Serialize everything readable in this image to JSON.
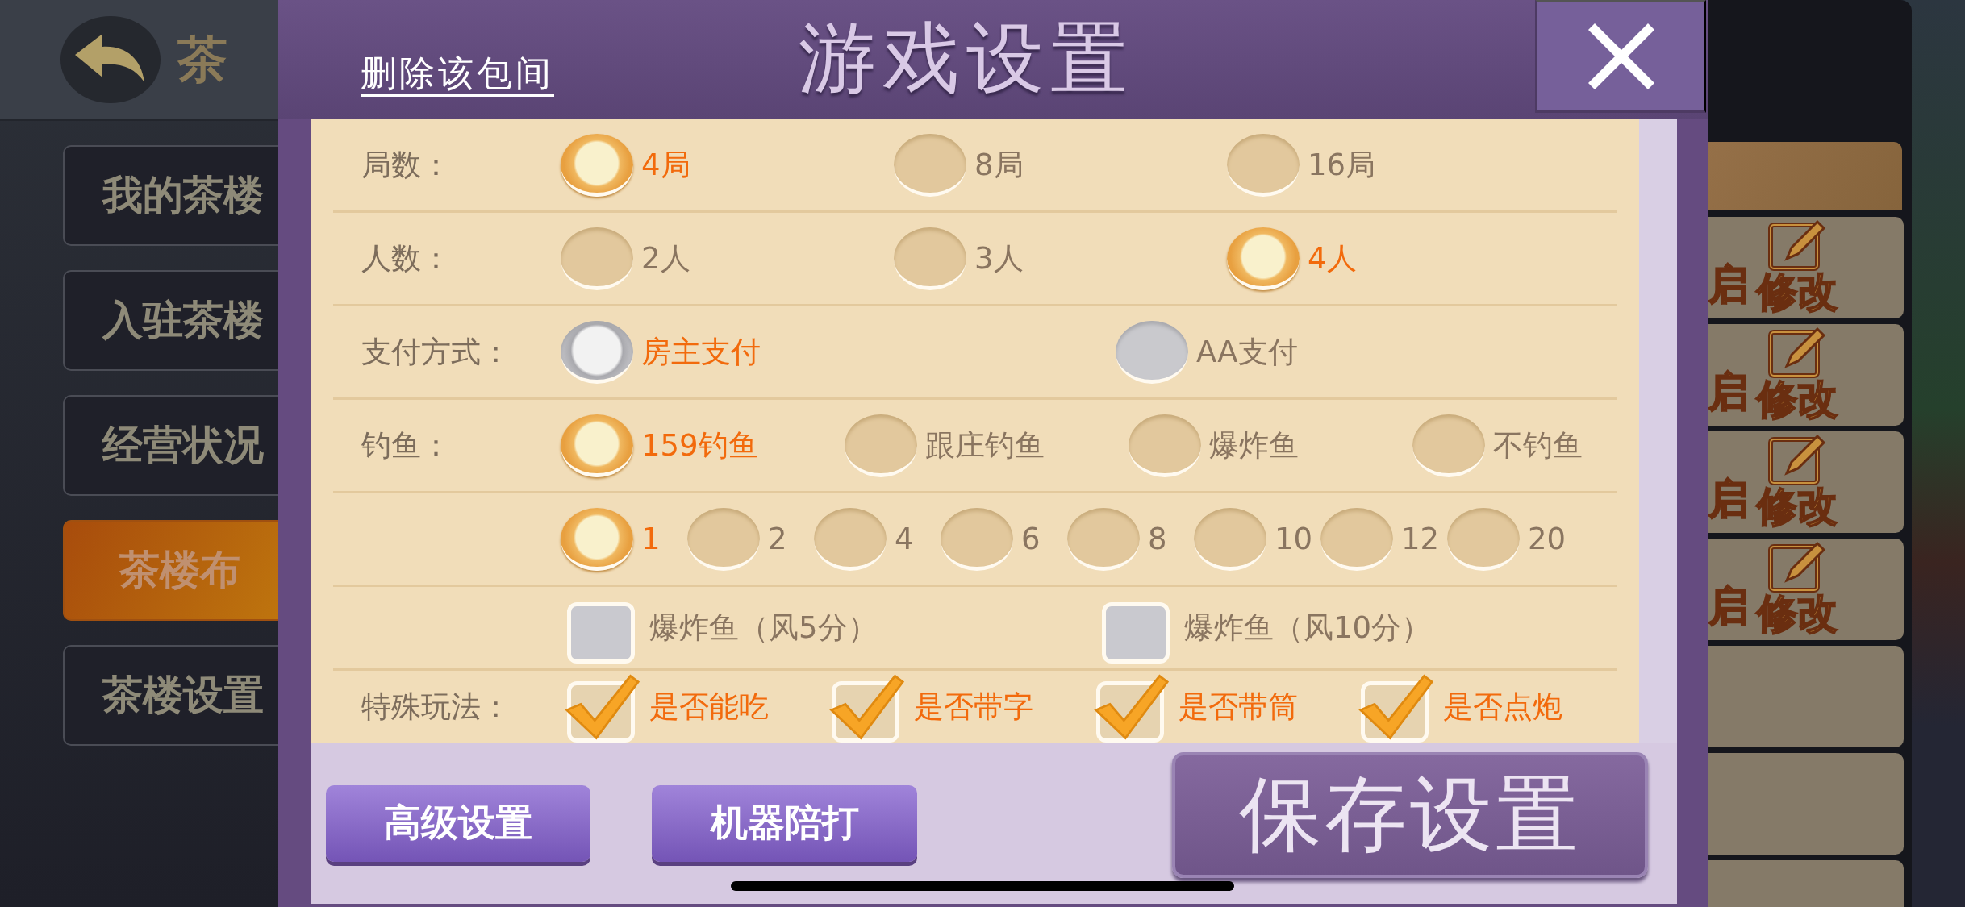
{
  "background": {
    "header_title": "茶",
    "sidebar": [
      {
        "label": "我的茶楼",
        "selected": false
      },
      {
        "label": "入驻茶楼",
        "selected": false
      },
      {
        "label": "经营状况",
        "selected": false
      },
      {
        "label": "茶楼布",
        "selected": true
      },
      {
        "label": "茶楼设置",
        "selected": false
      }
    ],
    "room_cards": [
      {
        "kind": "room",
        "open_label": "启",
        "edit_label": "修改"
      },
      {
        "kind": "room",
        "open_label": "启",
        "edit_label": "修改"
      },
      {
        "kind": "room",
        "open_label": "启",
        "edit_label": "修改"
      },
      {
        "kind": "room",
        "open_label": "启",
        "edit_label": "修改"
      },
      {
        "kind": "empty"
      },
      {
        "kind": "empty"
      },
      {
        "kind": "empty"
      }
    ]
  },
  "dialog": {
    "delete_link": "删除该包间",
    "title": "游戏设置",
    "rows": [
      {
        "label": "局数：",
        "kind": "radio",
        "options": [
          {
            "text": "4局",
            "selected": true
          },
          {
            "text": "8局",
            "selected": false
          },
          {
            "text": "16局",
            "selected": false
          }
        ]
      },
      {
        "label": "人数：",
        "kind": "radio",
        "options": [
          {
            "text": "2人",
            "selected": false
          },
          {
            "text": "3人",
            "selected": false
          },
          {
            "text": "4人",
            "selected": true
          }
        ]
      },
      {
        "label": "支付方式：",
        "kind": "gray-radio",
        "options": [
          {
            "text": "房主支付",
            "selected": true
          },
          {
            "text": "AA支付",
            "selected": false
          }
        ]
      },
      {
        "label": "钓鱼：",
        "kind": "radio",
        "options": [
          {
            "text": "159钓鱼",
            "selected": true
          },
          {
            "text": "跟庄钓鱼",
            "selected": false
          },
          {
            "text": "爆炸鱼",
            "selected": false
          },
          {
            "text": "不钓鱼",
            "selected": false
          }
        ]
      },
      {
        "kind": "radio",
        "options": [
          {
            "text": "1",
            "selected": true
          },
          {
            "text": "2",
            "selected": false
          },
          {
            "text": "4",
            "selected": false
          },
          {
            "text": "6",
            "selected": false
          },
          {
            "text": "8",
            "selected": false
          },
          {
            "text": "10",
            "selected": false
          },
          {
            "text": "12",
            "selected": false
          },
          {
            "text": "20",
            "selected": false
          }
        ]
      },
      {
        "kind": "checkbox",
        "options": [
          {
            "text": "爆炸鱼（风5分）",
            "checked": false
          },
          {
            "text": "爆炸鱼（风10分）",
            "checked": false
          }
        ]
      },
      {
        "label": "特殊玩法：",
        "kind": "checkbox",
        "options": [
          {
            "text": "是否能吃",
            "checked": true
          },
          {
            "text": "是否带字",
            "checked": true
          },
          {
            "text": "是否带筒",
            "checked": true
          },
          {
            "text": "是否点炮",
            "checked": true
          }
        ]
      }
    ],
    "buttons": [
      "高级设置",
      "机器陪打"
    ],
    "save_button": "保存设置"
  }
}
